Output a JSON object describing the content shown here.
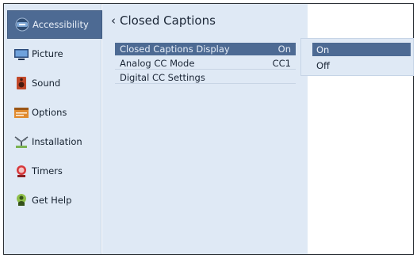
{
  "sidebar": {
    "items": [
      {
        "label": "Accessibility",
        "icon": "accessibility-icon",
        "active": true
      },
      {
        "label": "Picture",
        "icon": "picture-icon",
        "active": false
      },
      {
        "label": "Sound",
        "icon": "speaker-icon",
        "active": false
      },
      {
        "label": "Options",
        "icon": "options-icon",
        "active": false
      },
      {
        "label": "Installation",
        "icon": "antenna-icon",
        "active": false
      },
      {
        "label": "Timers",
        "icon": "alarm-icon",
        "active": false
      },
      {
        "label": "Get Help",
        "icon": "help-icon",
        "active": false
      }
    ]
  },
  "main": {
    "back_chevron": "‹",
    "title": "Closed Captions",
    "rows": [
      {
        "label": "Closed Captions Display",
        "value": "On",
        "selected": true
      },
      {
        "label": "Analog CC Mode",
        "value": "CC1",
        "selected": false
      },
      {
        "label": "Digital CC Settings",
        "value": "",
        "selected": false
      }
    ]
  },
  "popup": {
    "options": [
      {
        "label": "On",
        "selected": true
      },
      {
        "label": "Off",
        "selected": false
      }
    ]
  },
  "colors": {
    "panel_bg": "#dfe9f5",
    "highlight": "#4d6a93",
    "frame": "#2a2f35"
  }
}
